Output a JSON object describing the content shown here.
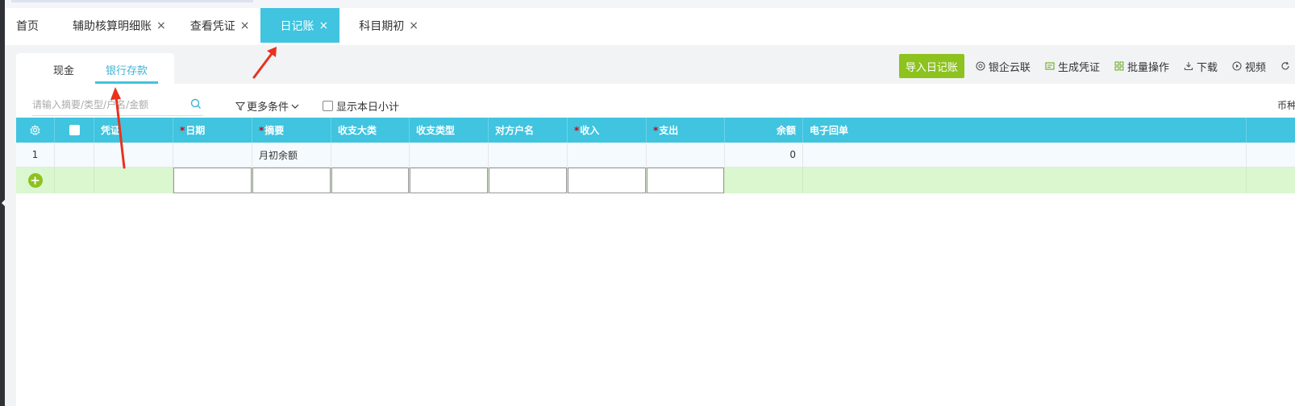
{
  "tabs": [
    {
      "label": "首页",
      "closable": false,
      "active": false
    },
    {
      "label": "辅助核算明细账",
      "closable": true,
      "active": false
    },
    {
      "label": "查看凭证",
      "closable": true,
      "active": false
    },
    {
      "label": "日记账",
      "closable": true,
      "active": true
    },
    {
      "label": "科目期初",
      "closable": true,
      "active": false
    }
  ],
  "close_glyph": "×",
  "subtabs": [
    {
      "label": "现金",
      "active": false
    },
    {
      "label": "银行存款",
      "active": true
    }
  ],
  "toolbar": {
    "import_label": "导入日记账",
    "bank_label": "银企云联",
    "gen_voucher_label": "生成凭证",
    "batch_label": "批量操作",
    "download_label": "下载",
    "video_label": "视频"
  },
  "filter": {
    "search_placeholder": "请输入摘要/类型/户名/金额",
    "more_label": "更多条件",
    "show_subtotal_label": "显示本日小计",
    "currency_label": "币种:"
  },
  "table": {
    "headers": [
      {
        "label": "凭证",
        "required": false
      },
      {
        "label": "日期",
        "required": true
      },
      {
        "label": "摘要",
        "required": true
      },
      {
        "label": "收支大类",
        "required": false
      },
      {
        "label": "收支类型",
        "required": false
      },
      {
        "label": "对方户名",
        "required": false
      },
      {
        "label": "收入",
        "required": true
      },
      {
        "label": "支出",
        "required": true
      },
      {
        "label": "余额",
        "required": false
      },
      {
        "label": "电子回单",
        "required": false
      }
    ],
    "rows": [
      {
        "index": "1",
        "summary": "月初余额",
        "balance": "0"
      }
    ]
  },
  "colors": {
    "accent": "#40c4df",
    "primary_green": "#8dc21f",
    "annotation_red": "#e8321e"
  }
}
